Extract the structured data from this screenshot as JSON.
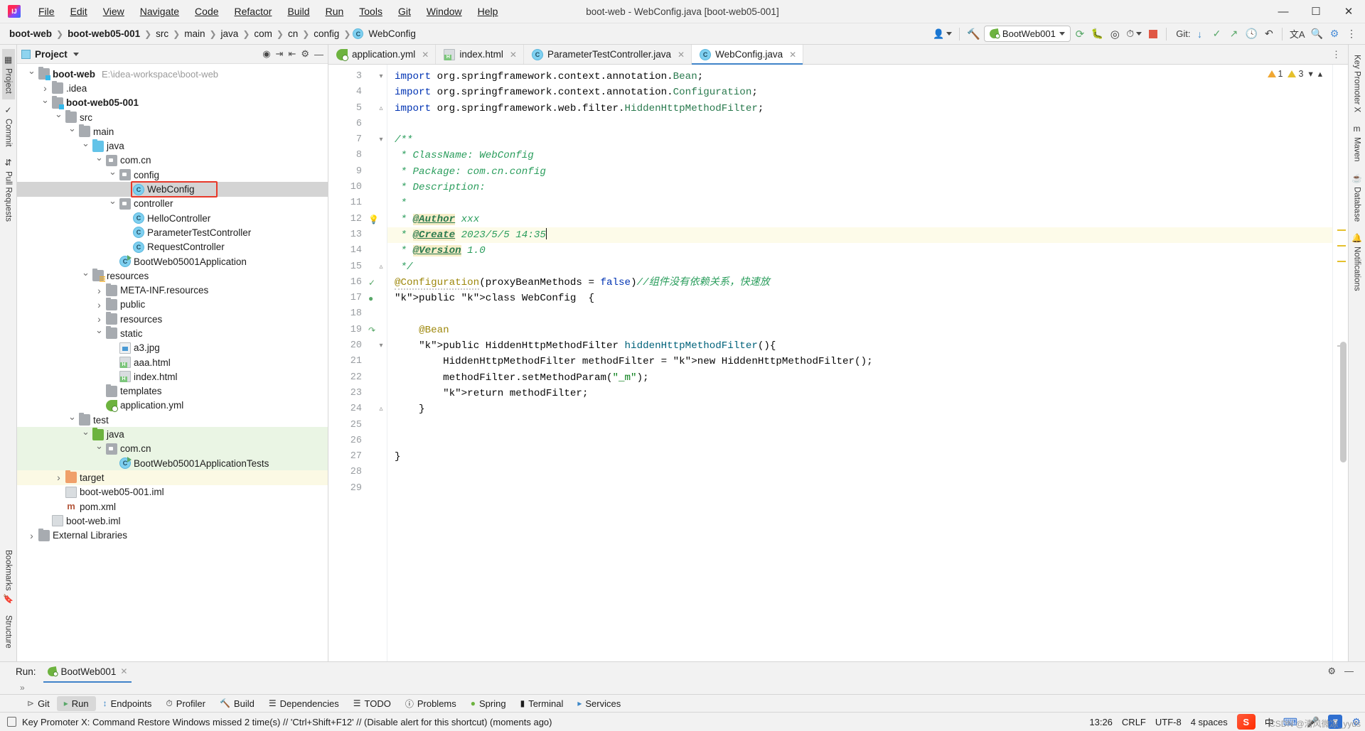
{
  "window": {
    "title": "boot-web - WebConfig.java [boot-web05-001]",
    "logo": "intellij-idea-logo",
    "controls": {
      "minimize": "—",
      "maximize": "❐",
      "close": "✕"
    }
  },
  "menubar": [
    {
      "label": "File"
    },
    {
      "label": "Edit"
    },
    {
      "label": "View"
    },
    {
      "label": "Navigate"
    },
    {
      "label": "Code"
    },
    {
      "label": "Refactor"
    },
    {
      "label": "Build"
    },
    {
      "label": "Run"
    },
    {
      "label": "Tools"
    },
    {
      "label": "Git"
    },
    {
      "label": "Window"
    },
    {
      "label": "Help"
    }
  ],
  "breadcrumb": [
    {
      "label": "boot-web",
      "bold": true
    },
    {
      "label": "boot-web05-001",
      "bold": true
    },
    {
      "label": "src",
      "bold": false
    },
    {
      "label": "main",
      "bold": false
    },
    {
      "label": "java",
      "bold": false
    },
    {
      "label": "com",
      "bold": false
    },
    {
      "label": "cn",
      "bold": false
    },
    {
      "label": "config",
      "bold": false
    },
    {
      "label": "WebConfig",
      "bold": false,
      "icon": "class-icon"
    }
  ],
  "toolbar_right": {
    "account_icon": "user-account-icon",
    "build_icon": "hammer-build-icon",
    "run_config": "BootWeb001",
    "run_icon": "run-icon",
    "debug_icon": "debug-icon",
    "run_with_coverage_icon": "coverage-icon",
    "profiler_icon": "profiler-icon",
    "stop_icon": "stop-icon",
    "git_label": "Git:",
    "git_update_icon": "update-project-icon",
    "git_commit_icon": "commit-icon",
    "git_push_icon": "push-icon",
    "history_icon": "history-icon",
    "undo_icon": "rollback-icon",
    "translate_icon": "translate-icon",
    "search_icon": "search-everywhere-icon",
    "settings_icon": "settings-icon",
    "more_icon": "more-options-icon"
  },
  "left_rail": [
    {
      "label": "Project",
      "icon": "project-icon",
      "active": true
    },
    {
      "label": "Commit",
      "icon": "commit-icon",
      "active": false
    },
    {
      "label": "Pull Requests",
      "icon": "pull-request-icon",
      "active": false
    },
    {
      "label": "Bookmarks",
      "icon": "bookmarks-icon",
      "active": false
    },
    {
      "label": "Structure",
      "icon": "structure-icon",
      "active": false
    }
  ],
  "right_rail": [
    {
      "label": "Key Promoter X",
      "icon": "key-promoter-icon"
    },
    {
      "label": "Maven",
      "icon": "maven-icon"
    },
    {
      "label": "Database",
      "icon": "database-icon"
    },
    {
      "label": "Notifications",
      "icon": "notifications-icon"
    }
  ],
  "project_panel": {
    "title": "Project",
    "actions": [
      "select-opened-file-icon",
      "expand-all-icon",
      "collapse-all-icon",
      "settings-icon",
      "hide-icon"
    ],
    "tree": [
      {
        "label": "boot-web",
        "path": "E:\\idea-workspace\\boot-web",
        "depth": 0,
        "arrow": "open",
        "icon": "module-folder",
        "bold": true
      },
      {
        "label": ".idea",
        "depth": 1,
        "arrow": "closed",
        "icon": "folder"
      },
      {
        "label": "boot-web05-001",
        "depth": 1,
        "arrow": "open",
        "icon": "module-folder",
        "bold": true
      },
      {
        "label": "src",
        "depth": 2,
        "arrow": "open",
        "icon": "folder"
      },
      {
        "label": "main",
        "depth": 3,
        "arrow": "open",
        "icon": "folder"
      },
      {
        "label": "java",
        "depth": 4,
        "arrow": "open",
        "icon": "folder-blue"
      },
      {
        "label": "com.cn",
        "depth": 5,
        "arrow": "open",
        "icon": "package"
      },
      {
        "label": "config",
        "depth": 6,
        "arrow": "open",
        "icon": "package"
      },
      {
        "label": "WebConfig",
        "depth": 7,
        "arrow": "none",
        "icon": "class",
        "selected": true,
        "highlighted": true
      },
      {
        "label": "controller",
        "depth": 6,
        "arrow": "open",
        "icon": "package"
      },
      {
        "label": "HelloController",
        "depth": 7,
        "arrow": "none",
        "icon": "class"
      },
      {
        "label": "ParameterTestController",
        "depth": 7,
        "arrow": "none",
        "icon": "class"
      },
      {
        "label": "RequestController",
        "depth": 7,
        "arrow": "none",
        "icon": "class"
      },
      {
        "label": "BootWeb05001Application",
        "depth": 6,
        "arrow": "none",
        "icon": "class-runnable"
      },
      {
        "label": "resources",
        "depth": 4,
        "arrow": "open",
        "icon": "folder-resources"
      },
      {
        "label": "META-INF.resources",
        "depth": 5,
        "arrow": "closed",
        "icon": "folder"
      },
      {
        "label": "public",
        "depth": 5,
        "arrow": "closed",
        "icon": "folder"
      },
      {
        "label": "resources",
        "depth": 5,
        "arrow": "closed",
        "icon": "folder"
      },
      {
        "label": "static",
        "depth": 5,
        "arrow": "open",
        "icon": "folder"
      },
      {
        "label": "a3.jpg",
        "depth": 6,
        "arrow": "none",
        "icon": "image"
      },
      {
        "label": "aaa.html",
        "depth": 6,
        "arrow": "none",
        "icon": "html"
      },
      {
        "label": "index.html",
        "depth": 6,
        "arrow": "none",
        "icon": "html"
      },
      {
        "label": "templates",
        "depth": 5,
        "arrow": "none",
        "icon": "folder"
      },
      {
        "label": "application.yml",
        "depth": 5,
        "arrow": "none",
        "icon": "spring"
      },
      {
        "label": "test",
        "depth": 3,
        "arrow": "open",
        "icon": "folder"
      },
      {
        "label": "java",
        "depth": 4,
        "arrow": "open",
        "icon": "folder-green",
        "green": true
      },
      {
        "label": "com.cn",
        "depth": 5,
        "arrow": "open",
        "icon": "package",
        "green": true
      },
      {
        "label": "BootWeb05001ApplicationTests",
        "depth": 6,
        "arrow": "none",
        "icon": "class-runnable",
        "green": true
      },
      {
        "label": "target",
        "depth": 2,
        "arrow": "closed",
        "icon": "folder-orange",
        "yellowish": true
      },
      {
        "label": "boot-web05-001.iml",
        "depth": 2,
        "arrow": "none",
        "icon": "iml"
      },
      {
        "label": "pom.xml",
        "depth": 2,
        "arrow": "none",
        "icon": "maven"
      },
      {
        "label": "boot-web.iml",
        "depth": 1,
        "arrow": "none",
        "icon": "iml"
      },
      {
        "label": "External Libraries",
        "depth": 0,
        "arrow": "closed",
        "icon": "library"
      }
    ]
  },
  "editor": {
    "tabs": [
      {
        "label": "application.yml",
        "icon": "spring-yml-icon",
        "active": false
      },
      {
        "label": "index.html",
        "icon": "html-icon",
        "active": false
      },
      {
        "label": "ParameterTestController.java",
        "icon": "class-icon",
        "active": false
      },
      {
        "label": "WebConfig.java",
        "icon": "class-icon",
        "active": true
      }
    ],
    "warnings": {
      "warning_count": "1",
      "weak_warning_count": "3"
    },
    "first_line_number": 3,
    "lines": [
      {
        "n": 3,
        "gutter": "fold-start",
        "text": "import org.springframework.context.annotation.Bean;"
      },
      {
        "n": 4,
        "gutter": "",
        "text": "import org.springframework.context.annotation.Configuration;"
      },
      {
        "n": 5,
        "gutter": "fold-end",
        "text": "import org.springframework.web.filter.HiddenHttpMethodFilter;"
      },
      {
        "n": 6,
        "gutter": "",
        "text": ""
      },
      {
        "n": 7,
        "gutter": "fold-start",
        "text": "/**"
      },
      {
        "n": 8,
        "gutter": "",
        "text": " * ClassName: WebConfig"
      },
      {
        "n": 9,
        "gutter": "",
        "text": " * Package: com.cn.config"
      },
      {
        "n": 10,
        "gutter": "",
        "text": " * Description:"
      },
      {
        "n": 11,
        "gutter": "",
        "text": " *"
      },
      {
        "n": 12,
        "gutter": "bulb",
        "text": " * @Author xxx"
      },
      {
        "n": 13,
        "gutter": "",
        "text": " * @Create 2023/5/5 14:35",
        "caret": true,
        "highlight": true
      },
      {
        "n": 14,
        "gutter": "",
        "text": " * @Version 1.0"
      },
      {
        "n": 15,
        "gutter": "fold-end",
        "text": " */"
      },
      {
        "n": 16,
        "gutter": "spring-bean",
        "text": "@Configuration(proxyBeanMethods = false)//组件没有依赖关系，快速放"
      },
      {
        "n": 17,
        "gutter": "spring-class",
        "text": "public class WebConfig  {"
      },
      {
        "n": 18,
        "gutter": "",
        "text": ""
      },
      {
        "n": 19,
        "gutter": "bean-arrow",
        "text": "    @Bean"
      },
      {
        "n": 20,
        "gutter": "fold-start",
        "text": "    public HiddenHttpMethodFilter hiddenHttpMethodFilter(){"
      },
      {
        "n": 21,
        "gutter": "",
        "text": "        HiddenHttpMethodFilter methodFilter = new HiddenHttpMethodFilter();"
      },
      {
        "n": 22,
        "gutter": "",
        "text": "        methodFilter.setMethodParam(\"_m\");"
      },
      {
        "n": 23,
        "gutter": "",
        "text": "        return methodFilter;"
      },
      {
        "n": 24,
        "gutter": "fold-end",
        "text": "    }"
      },
      {
        "n": 25,
        "gutter": "",
        "text": ""
      },
      {
        "n": 26,
        "gutter": "",
        "text": ""
      },
      {
        "n": 27,
        "gutter": "",
        "text": "}"
      },
      {
        "n": 28,
        "gutter": "",
        "text": ""
      },
      {
        "n": 29,
        "gutter": "",
        "text": ""
      }
    ]
  },
  "run_window": {
    "label": "Run:",
    "tab": "BootWeb001",
    "close_icon": "close-icon",
    "settings_icon": "settings-icon",
    "hide_icon": "hide-icon",
    "expand_icon": "expand-icon"
  },
  "bottom_bar": [
    {
      "label": "Git",
      "icon": "git-icon",
      "active": false
    },
    {
      "label": "Run",
      "icon": "run-icon",
      "active": true
    },
    {
      "label": "Endpoints",
      "icon": "endpoints-icon",
      "active": false
    },
    {
      "label": "Profiler",
      "icon": "profiler-icon",
      "active": false
    },
    {
      "label": "Build",
      "icon": "build-icon",
      "active": false
    },
    {
      "label": "Dependencies",
      "icon": "dependencies-icon",
      "active": false
    },
    {
      "label": "TODO",
      "icon": "todo-icon",
      "active": false
    },
    {
      "label": "Problems",
      "icon": "problems-icon",
      "active": false
    },
    {
      "label": "Spring",
      "icon": "spring-icon",
      "active": false
    },
    {
      "label": "Terminal",
      "icon": "terminal-icon",
      "active": false
    },
    {
      "label": "Services",
      "icon": "services-icon",
      "active": false
    }
  ],
  "status_bar": {
    "message_icon": "event-log-icon",
    "message": "Key Promoter X: Command Restore Windows missed 2 time(s) // 'Ctrl+Shift+F12' // (Disable alert for this shortcut) (moments ago)",
    "position": "13:26",
    "line_separator": "CRLF",
    "encoding": "UTF-8",
    "indent": "4 spaces",
    "lock_icon": "lock-icon",
    "ime": {
      "logo": "S",
      "lang": "中",
      "items": [
        "keyboard-icon",
        "microphone-icon",
        "pin-icon",
        "settings-icon"
      ]
    }
  },
  "watermark": "CSDN @清风微凉_yyds"
}
